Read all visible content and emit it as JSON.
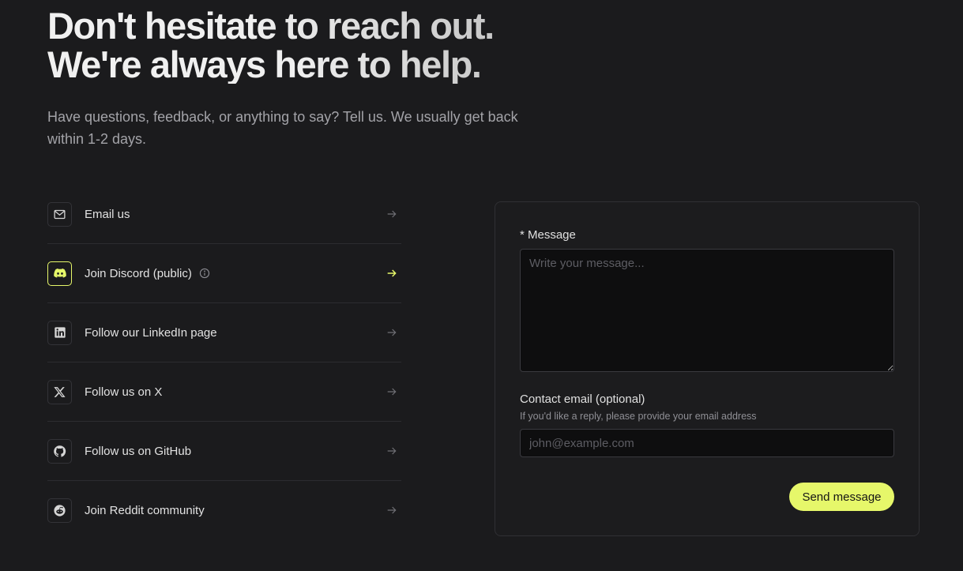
{
  "hero": {
    "title_line1": "Don't hesitate to reach out.",
    "title_line2": "We're always here to help.",
    "subtitle": "Have questions, feedback, or anything to say? Tell us. We usually get back within 1-2 days."
  },
  "links": [
    {
      "label": "Email us",
      "icon": "mail-icon"
    },
    {
      "label": "Join Discord (public)",
      "icon": "discord-icon",
      "has_info": true,
      "highlighted": true
    },
    {
      "label": "Follow our LinkedIn page",
      "icon": "linkedin-icon"
    },
    {
      "label": "Follow us on X",
      "icon": "x-icon"
    },
    {
      "label": "Follow us on GitHub",
      "icon": "github-icon"
    },
    {
      "label": "Join Reddit community",
      "icon": "reddit-icon"
    }
  ],
  "form": {
    "message_label": "* Message",
    "message_placeholder": "Write your message...",
    "message_value": "",
    "email_label": "Contact email (optional)",
    "email_help": "If you'd like a reply, please provide your email address",
    "email_placeholder": "john@example.com",
    "email_value": "",
    "send_label": "Send message"
  },
  "colors": {
    "background": "#1b1b1d",
    "accent": "#e6f76a",
    "muted_text": "#a3a3a8"
  }
}
